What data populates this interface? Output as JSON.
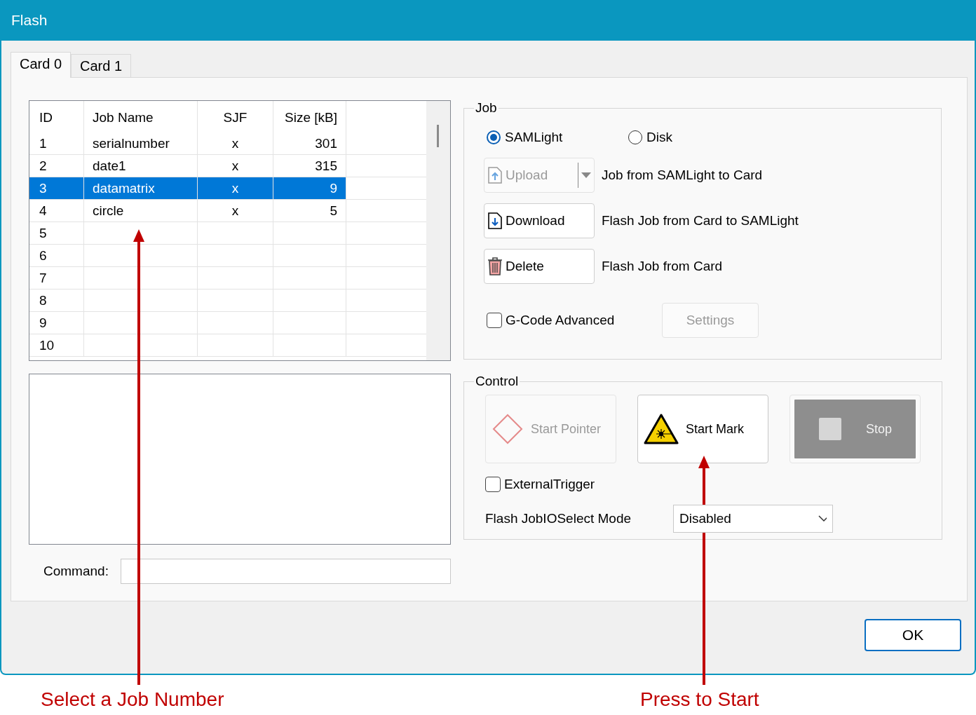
{
  "window": {
    "title": "Flash"
  },
  "tabs": [
    {
      "label": "Card 0",
      "selected": true
    },
    {
      "label": "Card 1",
      "selected": false
    }
  ],
  "job_table": {
    "columns": [
      "ID",
      "Job Name",
      "SJF",
      "Size [kB]"
    ],
    "rows": [
      {
        "cells": [
          "1",
          "serialnumber",
          "x",
          "301"
        ],
        "selected": false
      },
      {
        "cells": [
          "2",
          "date1",
          "x",
          "315"
        ],
        "selected": false
      },
      {
        "cells": [
          "3",
          "datamatrix",
          "x",
          "9"
        ],
        "selected": true
      },
      {
        "cells": [
          "4",
          "circle",
          "x",
          "5"
        ],
        "selected": false
      },
      {
        "cells": [
          "5"
        ],
        "selected": false
      },
      {
        "cells": [
          "6"
        ],
        "selected": false
      },
      {
        "cells": [
          "7"
        ],
        "selected": false
      },
      {
        "cells": [
          "8"
        ],
        "selected": false
      },
      {
        "cells": [
          "9"
        ],
        "selected": false
      },
      {
        "cells": [
          "10"
        ],
        "selected": false
      }
    ]
  },
  "command": {
    "label": "Command:"
  },
  "job_group": {
    "title": "Job",
    "source_options": [
      {
        "label": "SAMLight",
        "selected": true
      },
      {
        "label": "Disk",
        "selected": false
      }
    ],
    "actions": [
      {
        "button": "Upload",
        "kind": "upload",
        "disabled": true,
        "description": "Job from SAMLight to Card"
      },
      {
        "button": "Download",
        "kind": "download",
        "disabled": false,
        "description": "Flash Job from Card to SAMLight"
      },
      {
        "button": "Delete",
        "kind": "delete",
        "disabled": false,
        "description": "Flash Job from Card"
      }
    ],
    "gcode": {
      "label": "G-Code Advanced",
      "checked": false
    },
    "settings_button": {
      "label": "Settings",
      "disabled": true
    }
  },
  "control_group": {
    "title": "Control",
    "buttons": [
      {
        "label": "Start Pointer",
        "kind": "pointer",
        "disabled": true
      },
      {
        "label": "Start Mark",
        "kind": "mark",
        "disabled": false
      },
      {
        "label": "Stop",
        "kind": "stop",
        "disabled": true
      }
    ],
    "external_trigger": {
      "label": "ExternalTrigger",
      "checked": false
    },
    "io_select": {
      "label": "Flash JobIOSelect Mode",
      "value": "Disabled"
    }
  },
  "ok_button": "OK",
  "annotations": [
    {
      "text": "Select a Job Number"
    },
    {
      "text": "Press to Start"
    }
  ]
}
